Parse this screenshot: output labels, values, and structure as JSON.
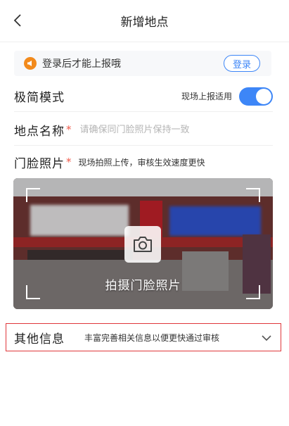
{
  "header": {
    "title": "新增地点"
  },
  "banner": {
    "text": "登录后才能上报哦",
    "login_label": "登录"
  },
  "simple_mode": {
    "label": "极简模式",
    "hint": "现场上报适用",
    "enabled": true
  },
  "place_name": {
    "label": "地点名称",
    "required_mark": "*",
    "placeholder": "请确保同门脸照片保持一致"
  },
  "storefront_photo": {
    "label": "门脸照片",
    "required_mark": "*",
    "hint": "现场拍照上传，审核生效速度更快",
    "capture_label": "拍摄门脸照片"
  },
  "other_info": {
    "label": "其他信息",
    "hint": "丰富完善相关信息以便更快通过审核"
  },
  "colors": {
    "accent": "#3d86f7",
    "required": "#f05a4a",
    "highlight_border": "#e0373b",
    "banner_icon": "#f28a1c"
  }
}
